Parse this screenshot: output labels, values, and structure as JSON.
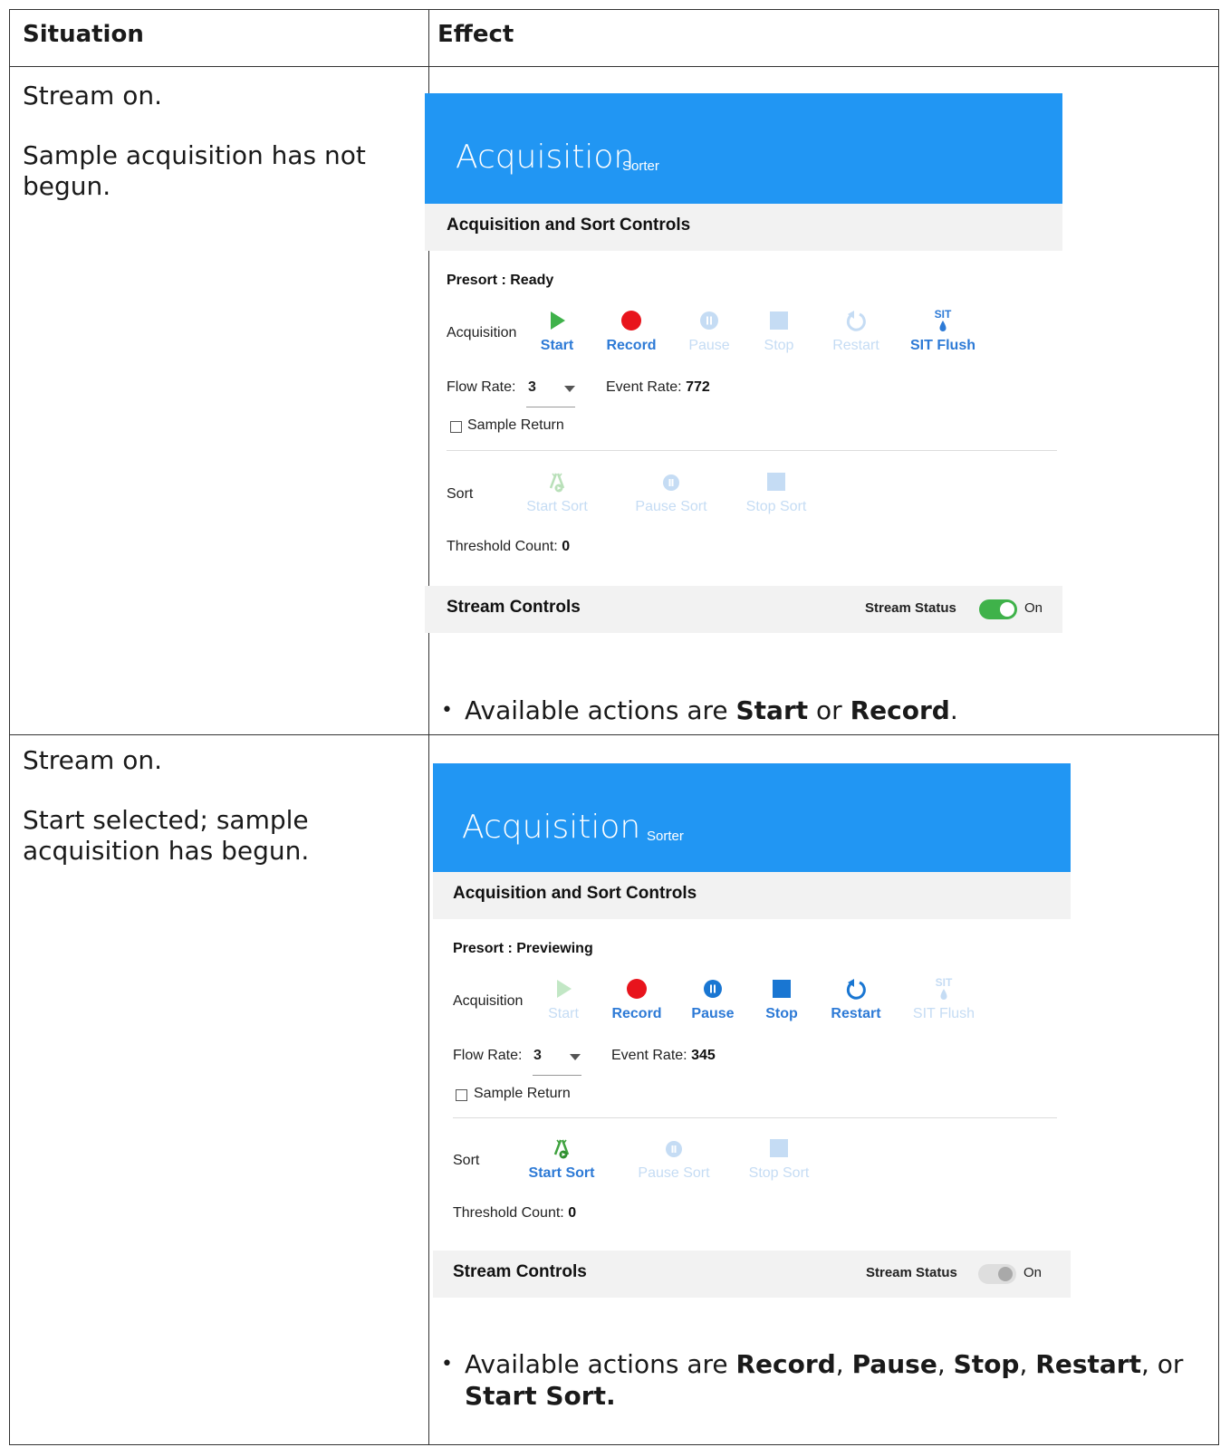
{
  "table": {
    "headers": {
      "situation": "Situation",
      "effect": "Effect"
    },
    "rows": [
      {
        "situation_line1": "Stream on.",
        "situation_line2": "Sample acquisition has not begun.",
        "panel": {
          "title": "Acquisition",
          "subtitle": "Sorter",
          "section1": "Acquisition and Sort Controls",
          "presort_label": "Presort :",
          "presort_value": "Ready",
          "acq_label": "Acquisition",
          "buttons": {
            "start": "Start",
            "record": "Record",
            "pause": "Pause",
            "stop": "Stop",
            "restart": "Restart",
            "sit": "SIT Flush",
            "sit_icon_text": "SIT"
          },
          "flow_label": "Flow Rate:",
          "flow_value": "3",
          "event_label": "Event Rate:",
          "event_value": "772",
          "sample_return": "Sample Return",
          "sort_label": "Sort",
          "sort_buttons": {
            "start_sort": "Start Sort",
            "pause_sort": "Pause Sort",
            "stop_sort": "Stop Sort"
          },
          "threshold_label": "Threshold Count:",
          "threshold_value": "0",
          "section2": "Stream Controls",
          "stream_status_label": "Stream Status",
          "stream_status_value": "On",
          "stream_toggle": "on"
        },
        "bullet_prefix": "Available actions are ",
        "bullet_b1": "Start",
        "bullet_mid": " or ",
        "bullet_b2": "Record",
        "bullet_end": "."
      },
      {
        "situation_line1": "Stream on.",
        "situation_line2": "Start selected; sample acquisition has begun.",
        "panel": {
          "title": "Acquisition",
          "subtitle": "Sorter",
          "section1": "Acquisition and Sort Controls",
          "presort_label": "Presort :",
          "presort_value": "Previewing",
          "acq_label": "Acquisition",
          "buttons": {
            "start": "Start",
            "record": "Record",
            "pause": "Pause",
            "stop": "Stop",
            "restart": "Restart",
            "sit": "SIT Flush",
            "sit_icon_text": "SIT"
          },
          "flow_label": "Flow Rate:",
          "flow_value": "3",
          "event_label": "Event Rate:",
          "event_value": "345",
          "sample_return": "Sample Return",
          "sort_label": "Sort",
          "sort_buttons": {
            "start_sort": "Start Sort",
            "pause_sort": "Pause Sort",
            "stop_sort": "Stop Sort"
          },
          "threshold_label": "Threshold Count:",
          "threshold_value": "0",
          "section2": "Stream Controls",
          "stream_status_label": "Stream Status",
          "stream_status_value": "On",
          "stream_toggle": "off"
        },
        "bullet_prefix": "Available actions are ",
        "bullet_b1": "Record",
        "bullet_sep1": ", ",
        "bullet_b2": "Pause",
        "bullet_sep2": ", ",
        "bullet_b3": "Stop",
        "bullet_sep3": ", ",
        "bullet_b4": "Restart",
        "bullet_sep4": ", or ",
        "bullet_b5": "Start Sort."
      }
    ]
  },
  "colors": {
    "banner": "#2196f3",
    "accent": "#2d7ad6",
    "play_green": "#3fb24a",
    "record_red": "#e8141c",
    "disabled": "#c5dcf4"
  }
}
